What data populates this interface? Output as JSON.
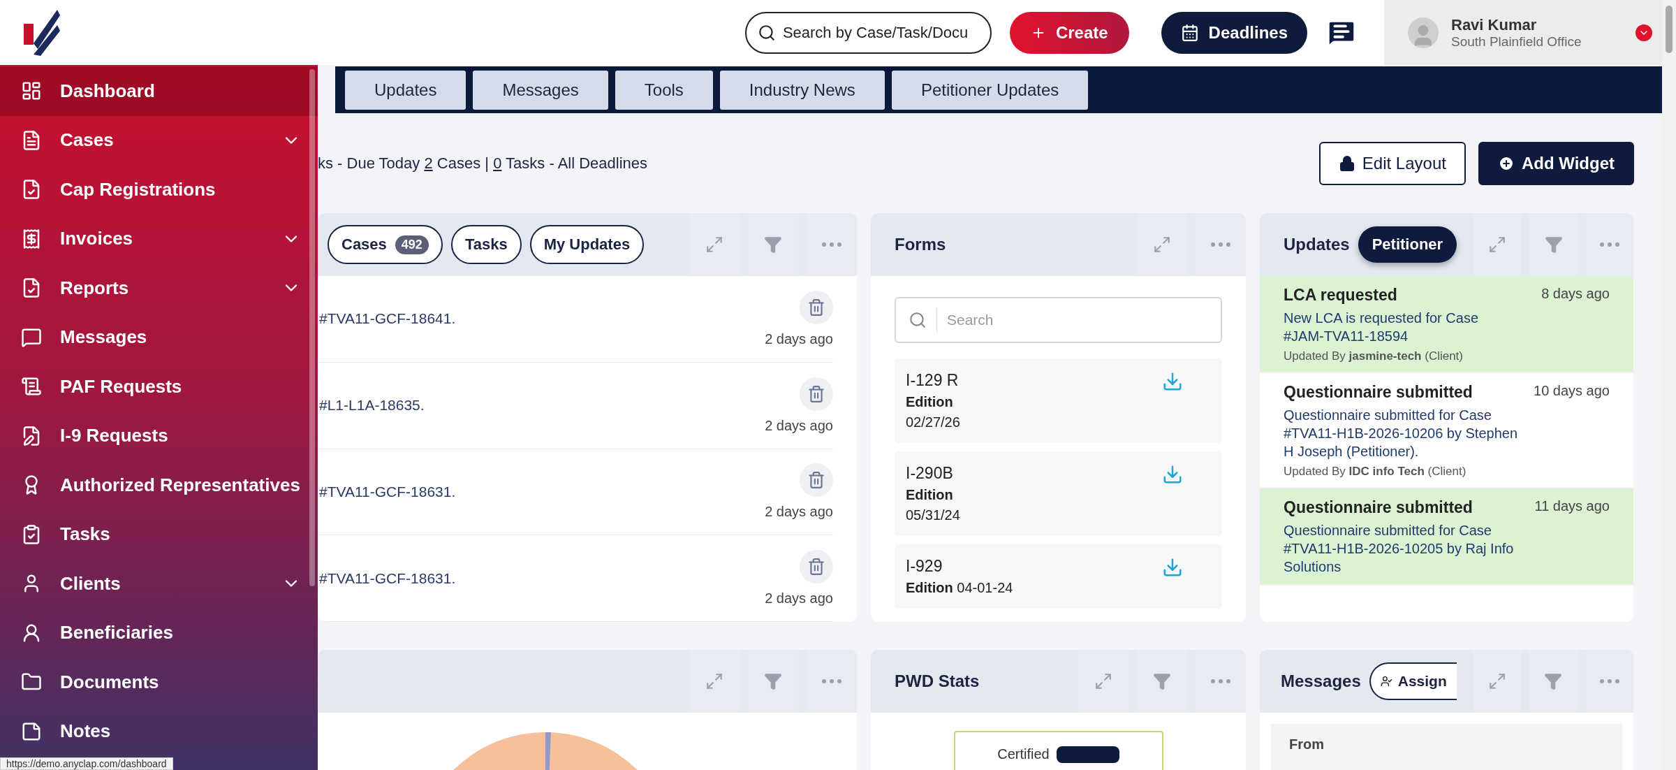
{
  "sidebar": {
    "items": [
      {
        "label": "Dashboard",
        "selected": true,
        "expandable": false
      },
      {
        "label": "Cases",
        "selected": false,
        "expandable": true
      },
      {
        "label": "Cap Registrations",
        "selected": false,
        "expandable": false
      },
      {
        "label": "Invoices",
        "selected": false,
        "expandable": true
      },
      {
        "label": "Reports",
        "selected": false,
        "expandable": true
      },
      {
        "label": "Messages",
        "selected": false,
        "expandable": false
      },
      {
        "label": "PAF Requests",
        "selected": false,
        "expandable": false
      },
      {
        "label": "I-9 Requests",
        "selected": false,
        "expandable": false
      },
      {
        "label": "Authorized Representatives",
        "selected": false,
        "expandable": false
      },
      {
        "label": "Tasks",
        "selected": false,
        "expandable": false
      },
      {
        "label": "Clients",
        "selected": false,
        "expandable": true
      },
      {
        "label": "Beneficiaries",
        "selected": false,
        "expandable": false
      },
      {
        "label": "Documents",
        "selected": false,
        "expandable": false
      },
      {
        "label": "Notes",
        "selected": false,
        "expandable": false
      }
    ]
  },
  "status_url": "https://demo.anyclap.com/dashboard",
  "header": {
    "search": {
      "placeholder": "Search by Case/Task/Docu"
    },
    "create_button": "Create",
    "deadlines_button": "Deadlines",
    "user": {
      "name": "Ravi Kumar",
      "office": "South Plainfield Office"
    }
  },
  "tabs": [
    {
      "label": "Updates",
      "selected": false
    },
    {
      "label": "Messages",
      "selected": false
    },
    {
      "label": "Tools",
      "selected": false
    },
    {
      "label": "Industry News",
      "selected": false
    },
    {
      "label": "Petitioner Updates",
      "selected": false
    }
  ],
  "summary": [
    {
      "text": "ks - Due Today ",
      "link": false
    },
    {
      "text": "2",
      "link": true
    },
    {
      "text": " Cases | ",
      "link": false
    },
    {
      "text": "0",
      "link": true
    },
    {
      "text": " Tasks - All Deadlines",
      "link": false
    }
  ],
  "layout_buttons": {
    "edit": "Edit Layout",
    "add": "Add Widget"
  },
  "cases_widget": {
    "chips": [
      {
        "label": "Cases",
        "count": "492",
        "selected": false
      },
      {
        "label": "Tasks",
        "selected": false
      },
      {
        "label": "My Updates",
        "selected": false
      }
    ],
    "rows": [
      {
        "text": "#TVA11-GCF-18641.",
        "time": "2 days ago"
      },
      {
        "text": "#L1-L1A-18635.",
        "time": "2 days ago"
      },
      {
        "text": "#TVA11-GCF-18631.",
        "time": "2 days ago"
      },
      {
        "text": "#TVA11-GCF-18631.",
        "time": "2 days ago"
      }
    ]
  },
  "forms_widget": {
    "title": "Forms",
    "search": {
      "placeholder": "Search"
    },
    "items": [
      {
        "name": "I-129 R",
        "edition_label": "Edition",
        "edition": "02/27/26",
        "kind": "stacked"
      },
      {
        "name": "I-290B",
        "edition_label": "Edition",
        "edition": "05/31/24",
        "kind": "stacked"
      },
      {
        "name": "I-929",
        "edition_label": "Edition",
        "edition": "04-01-24",
        "kind": "inline"
      }
    ]
  },
  "updates_widget": {
    "title": "Updates",
    "filter": "Petitioner",
    "items": [
      {
        "title": "LCA requested",
        "time": "8 days ago",
        "body": "New LCA is requested for Case #JAM-TVA11-18594",
        "updated_by": "Updated By **jasmine-tech** (Client)",
        "highlighted": true
      },
      {
        "title": "Questionnaire submitted",
        "time": "10 days ago",
        "body": "Questionnaire submitted for Case #TVA11-H1B-2026-10206 by Stephen H Joseph (Petitioner).",
        "updated_by": "Updated By **IDC info Tech** (Client)",
        "highlighted": false
      },
      {
        "title": "Questionnaire submitted",
        "time": "11 days ago",
        "body": "Questionnaire submitted for Case #TVA11-H1B-2026-10205 by Raj Info Solutions",
        "highlighted": true
      }
    ]
  },
  "pwd_widget": {
    "title": "PWD Stats",
    "status": "Certified"
  },
  "messages_widget": {
    "title": "Messages",
    "assign_button": "Assign",
    "column": "From"
  }
}
